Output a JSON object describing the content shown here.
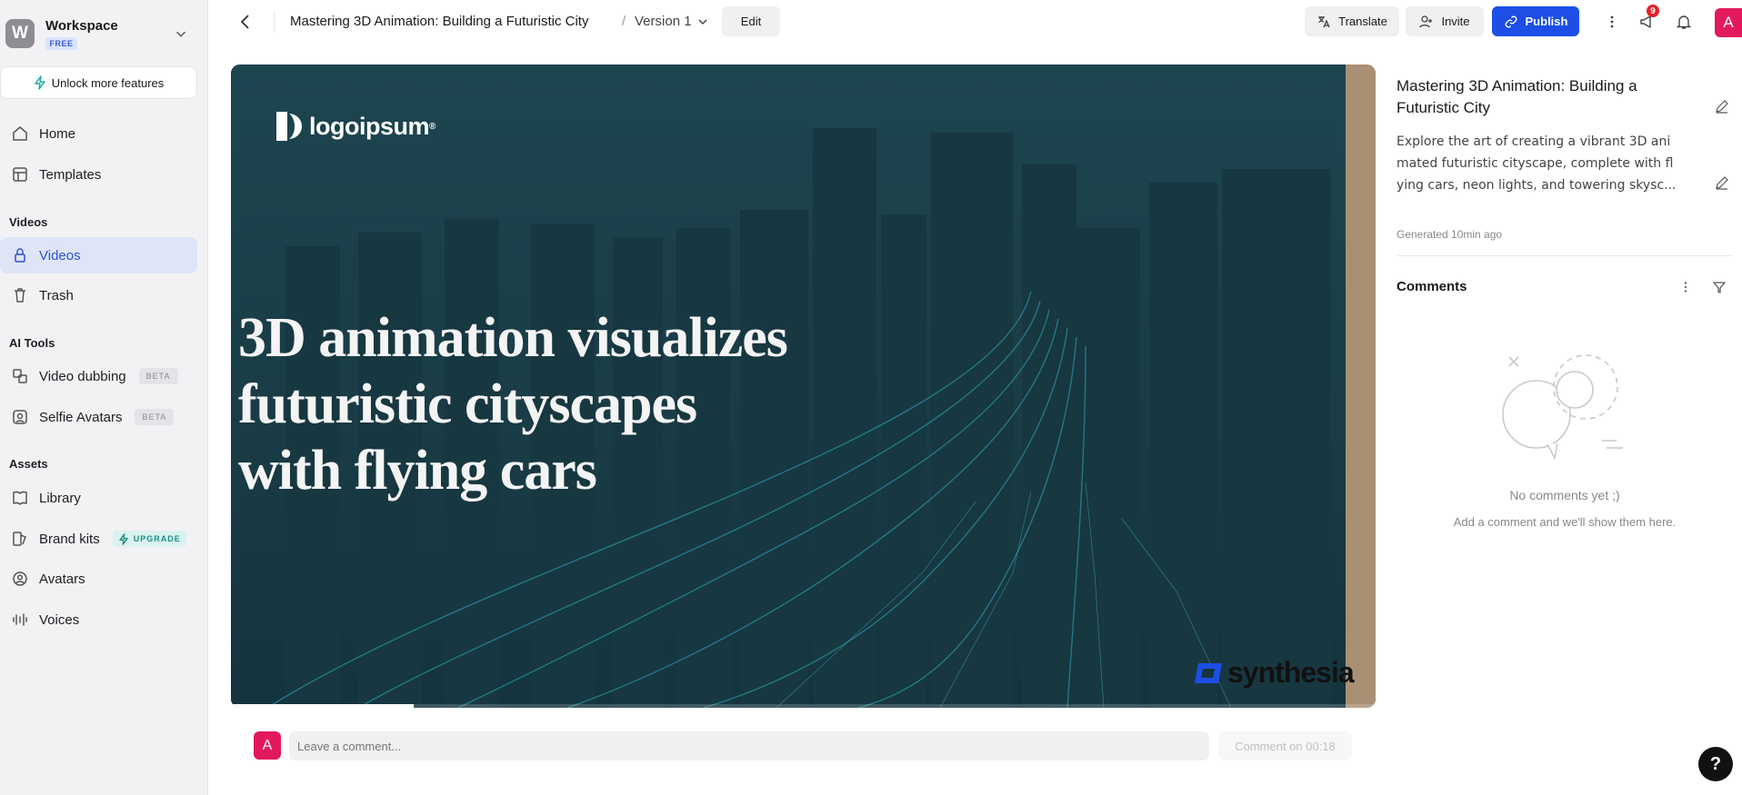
{
  "workspace": {
    "initial": "W",
    "name": "Workspace",
    "plan": "FREE"
  },
  "sidebar": {
    "unlock_label": "Unlock more features",
    "items": [
      {
        "label": "Home",
        "icon": "home-icon"
      },
      {
        "label": "Templates",
        "icon": "templates-icon"
      }
    ],
    "videos_section": "Videos",
    "videos_items": [
      {
        "label": "Videos",
        "icon": "lock-icon",
        "active": true
      },
      {
        "label": "Trash",
        "icon": "trash-icon"
      }
    ],
    "ai_section": "AI Tools",
    "ai_items": [
      {
        "label": "Video dubbing",
        "icon": "dubbing-icon",
        "badge": "BETA"
      },
      {
        "label": "Selfie Avatars",
        "icon": "selfie-icon",
        "badge": "BETA"
      }
    ],
    "assets_section": "Assets",
    "assets_items": [
      {
        "label": "Library",
        "icon": "book-icon"
      },
      {
        "label": "Brand kits",
        "icon": "brand-icon",
        "badge": "UPGRADE"
      },
      {
        "label": "Avatars",
        "icon": "avatar-icon"
      },
      {
        "label": "Voices",
        "icon": "voice-icon"
      }
    ]
  },
  "header": {
    "title": "Mastering 3D Animation: Building a Futuristic City",
    "separator": "/",
    "version": "Version 1",
    "edit_label": "Edit",
    "translate_label": "Translate",
    "invite_label": "Invite",
    "publish_label": "Publish",
    "notification_count": "9",
    "user_initial": "A"
  },
  "video": {
    "logo_text": "logoipsum",
    "logo_mark": "®",
    "headline": [
      "3D animation visualizes",
      "futuristic cityscapes",
      "with flying cars"
    ],
    "watermark": "synthesia",
    "progress": 0.16
  },
  "comment_bar": {
    "user_initial": "A",
    "placeholder": "Leave a comment...",
    "button_label": "Comment on 00:18"
  },
  "details": {
    "title": "Mastering 3D Animation: Building a Futuristic City",
    "description_lines": [
      "Explore the art of creating a vibrant 3D ani",
      "mated futuristic cityscape, complete with fl",
      "ying cars, neon lights, and towering skysc..."
    ],
    "generated": "Generated 10min ago",
    "comments_heading": "Comments",
    "empty_title": "No comments yet ;)",
    "empty_sub": "Add a comment and we'll show them here."
  },
  "help_label": "?",
  "colors": {
    "accent": "#1d4ee6",
    "active_bg": "#dfe4f6",
    "user": "#e3195d",
    "video_bg": "#1d3f4a"
  }
}
